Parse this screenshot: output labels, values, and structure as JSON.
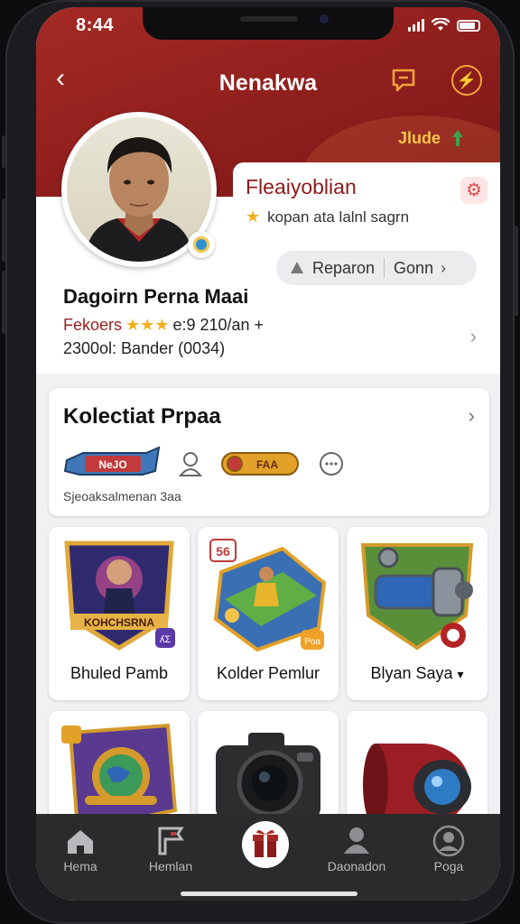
{
  "status_bar": {
    "time": "8:44"
  },
  "header": {
    "title": "Nenakwa",
    "badge_label": "Jlude"
  },
  "profile": {
    "info_title": "Fleaiyoblian",
    "info_subtitle": "kopan ata lalnl sagrn",
    "report_button": "Reparon",
    "secondary_button": "Gonn",
    "name": "Dagoirn Perna Maai",
    "stats_label": "Fekoers",
    "stats_value": "e:9 210/an +",
    "stats_line2": "2300ol: Bander (0034)"
  },
  "collection": {
    "title": "Kolectiat Prpaa",
    "subtitle": "Sjeoaksalmenan 3aa",
    "badge_text_1": "NeJO",
    "badge_text_2": "FAA"
  },
  "grid": {
    "tiles": [
      {
        "label": "Bhuled Pamb",
        "art_text": "KOHCHSRNA",
        "corner": "ʎΣ"
      },
      {
        "label": "Kolder Pemlur",
        "art_text": "56",
        "corner": "Poa"
      },
      {
        "label": "Blyan Saya",
        "art_text": "",
        "corner": ""
      },
      {
        "label": "",
        "art_text": "",
        "corner": ""
      },
      {
        "label": "",
        "art_text": "",
        "corner": ""
      },
      {
        "label": "",
        "art_text": "",
        "corner": ""
      }
    ]
  },
  "bottom_nav": {
    "items": [
      {
        "label": "Hema",
        "icon": "home-icon"
      },
      {
        "label": "Hemlan",
        "icon": "flag-icon"
      },
      {
        "label": "",
        "icon": "gift-icon"
      },
      {
        "label": "Daonadon",
        "icon": "person-icon"
      },
      {
        "label": "Poga",
        "icon": "profile-icon"
      }
    ]
  },
  "colors": {
    "header_red": "#a52a24",
    "accent_orange": "#f2a33a",
    "nav_dark": "#2b2b2d"
  }
}
